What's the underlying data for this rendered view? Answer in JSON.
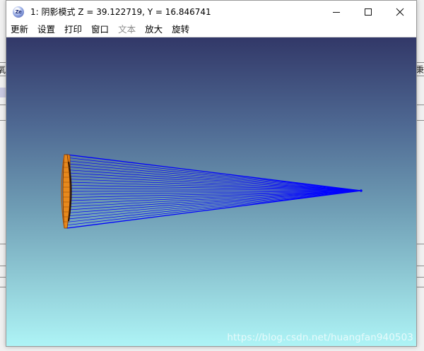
{
  "window": {
    "icon_label": "Ze",
    "title": "1: 阴影模式 Z = 39.122719, Y = 16.846741",
    "controls": {
      "minimize": "—",
      "maximize": "☐",
      "close": "✕"
    }
  },
  "menu": [
    {
      "label": "更新",
      "enabled": true
    },
    {
      "label": "设置",
      "enabled": true
    },
    {
      "label": "打印",
      "enabled": true
    },
    {
      "label": "窗口",
      "enabled": true
    },
    {
      "label": "文本",
      "enabled": false
    },
    {
      "label": "放大",
      "enabled": true
    },
    {
      "label": "旋转",
      "enabled": true
    }
  ],
  "viewport": {
    "gradient_top": "#323868",
    "gradient_bottom": "#aef4f6",
    "ray_color": "#0000ff",
    "lens_color": "#e07a10",
    "lens_edge_color": "#7a3a08"
  },
  "background_app": {
    "left_glyph": "氧",
    "right_glyph": "秉"
  },
  "watermark": "https://blog.csdn.net/huangfan940503"
}
